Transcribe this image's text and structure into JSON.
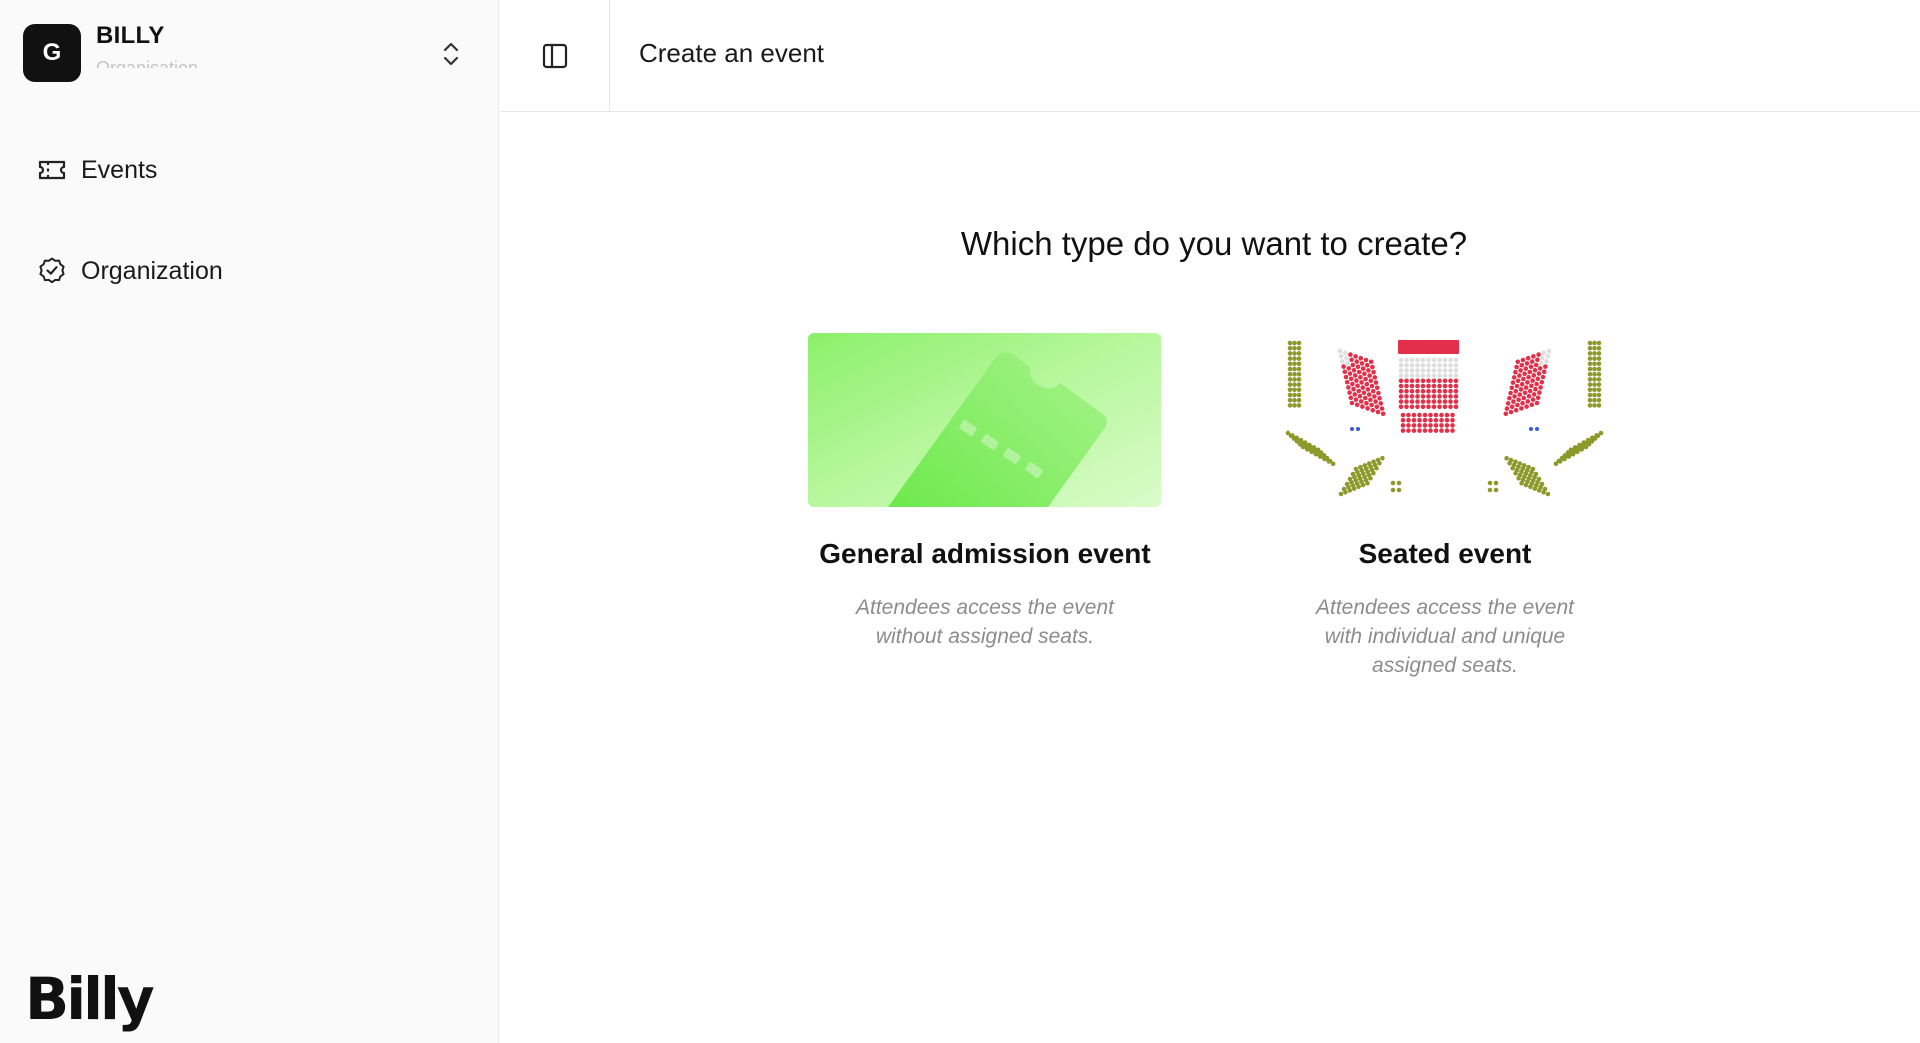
{
  "org": {
    "initial": "G",
    "name": "BILLY",
    "subtitle": "Organisation"
  },
  "nav": {
    "items": [
      {
        "label": "Events",
        "icon": "ticket-icon"
      },
      {
        "label": "Organization",
        "icon": "badge-check-icon"
      }
    ]
  },
  "brand": {
    "logo_text": "Billy"
  },
  "header": {
    "title": "Create an event"
  },
  "main": {
    "question": "Which type do you want to create?",
    "options": [
      {
        "title": "General admission event",
        "description": "Attendees access the event without assigned seats.",
        "illustration": "green-ticket-illustration"
      },
      {
        "title": "Seated event",
        "description": "Attendees access the event with individual and unique assigned seats.",
        "illustration": "seat-map-illustration"
      }
    ]
  },
  "colors": {
    "accent_green": "#7dea5a",
    "seat_red": "#e2304a",
    "seat_olive": "#8c9a2c",
    "seat_grey": "#dedede",
    "text_muted": "#8c8c8c"
  }
}
